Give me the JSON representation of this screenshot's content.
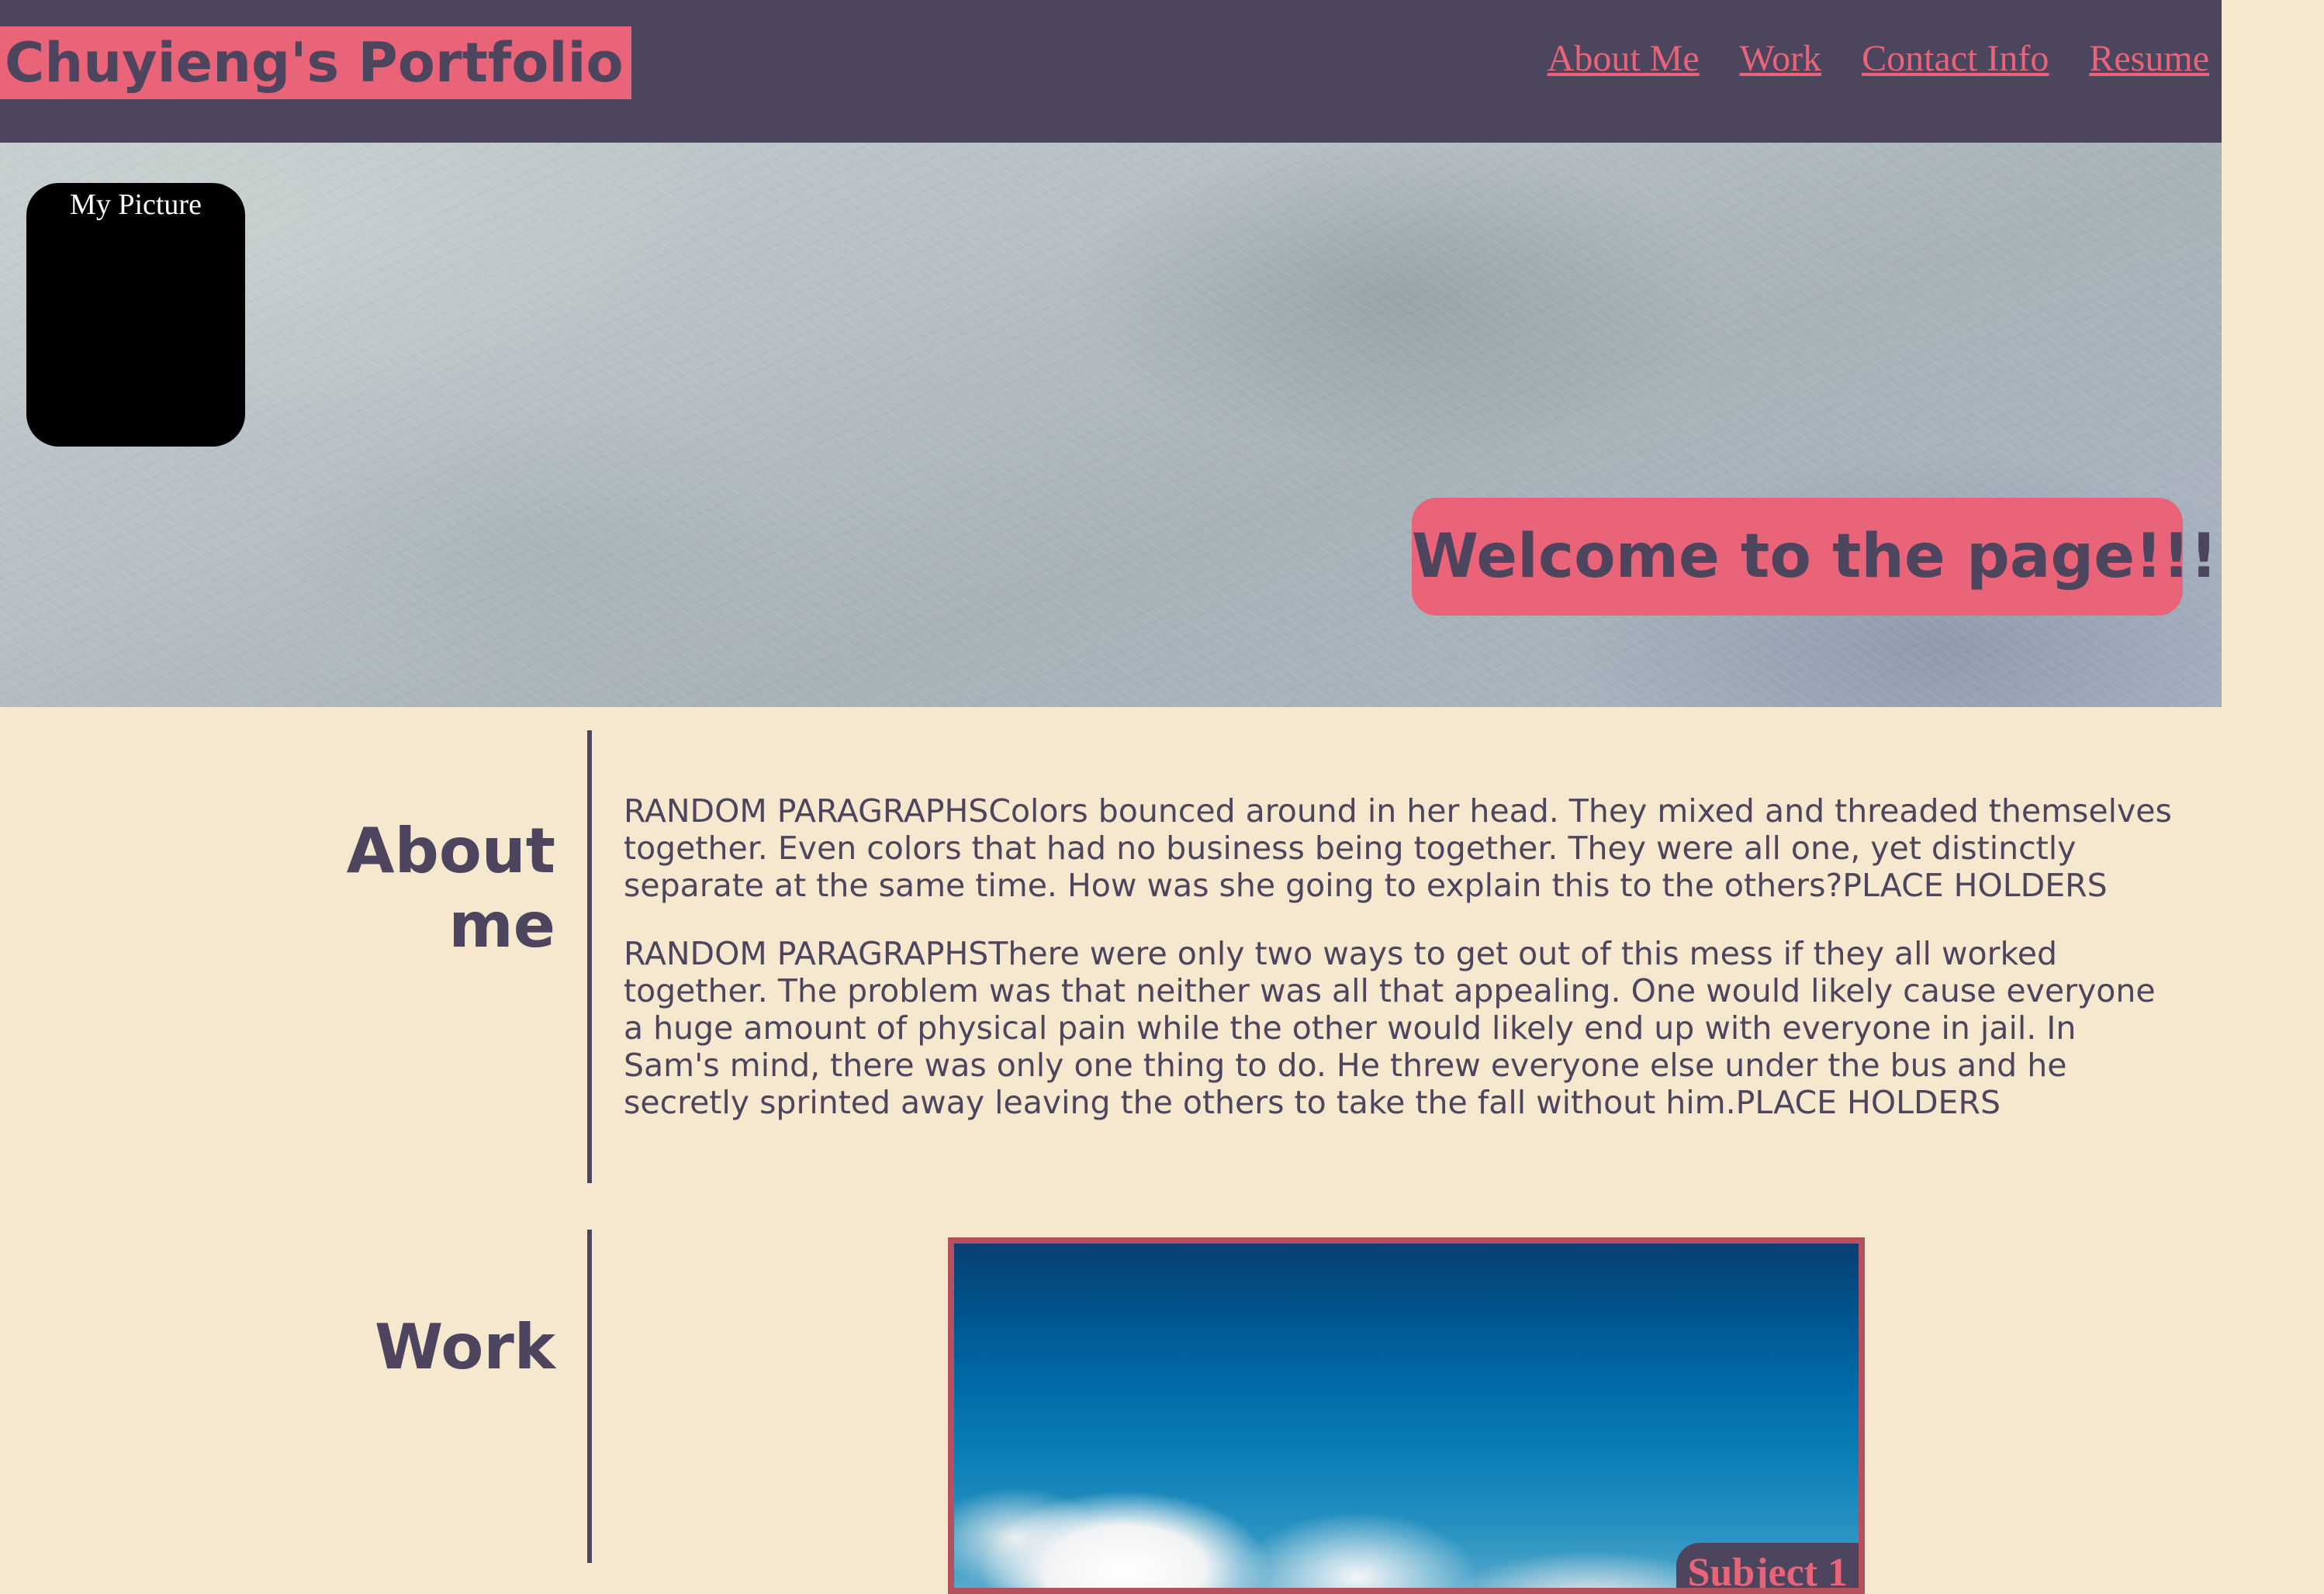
{
  "header": {
    "site_title": "Chuyieng's Portfolio",
    "nav": [
      {
        "label": "About Me"
      },
      {
        "label": "Work"
      },
      {
        "label": "Contact Info"
      },
      {
        "label": "Resume"
      }
    ]
  },
  "hero": {
    "picture_alt": "My Picture",
    "welcome": "Welcome to the page!!!!"
  },
  "about": {
    "heading_line1": "About",
    "heading_line2": "me",
    "paragraphs": [
      "RANDOM PARAGRAPHSColors bounced around in her head. They mixed and threaded themselves together. Even colors that had no business being together. They were all one, yet distinctly separate at the same time. How was she going to explain this to the others?PLACE HOLDERS",
      "RANDOM PARAGRAPHSThere were only two ways to get out of this mess if they all worked together. The problem was that neither was all that appealing. One would likely cause everyone a huge amount of physical pain while the other would likely end up with everyone in jail. In Sam's mind, there was only one thing to do. He threw everyone else under the bus and he secretly sprinted away leaving the others to take the fall without him.PLACE HOLDERS"
    ]
  },
  "work": {
    "heading": "Work",
    "cards": [
      {
        "label": "Subject 1"
      }
    ]
  },
  "colors": {
    "header_bg": "#4d455d",
    "accent_pink": "#e96479",
    "page_bg": "#f5e8ce",
    "card_border": "#b5505f"
  },
  "icons": []
}
